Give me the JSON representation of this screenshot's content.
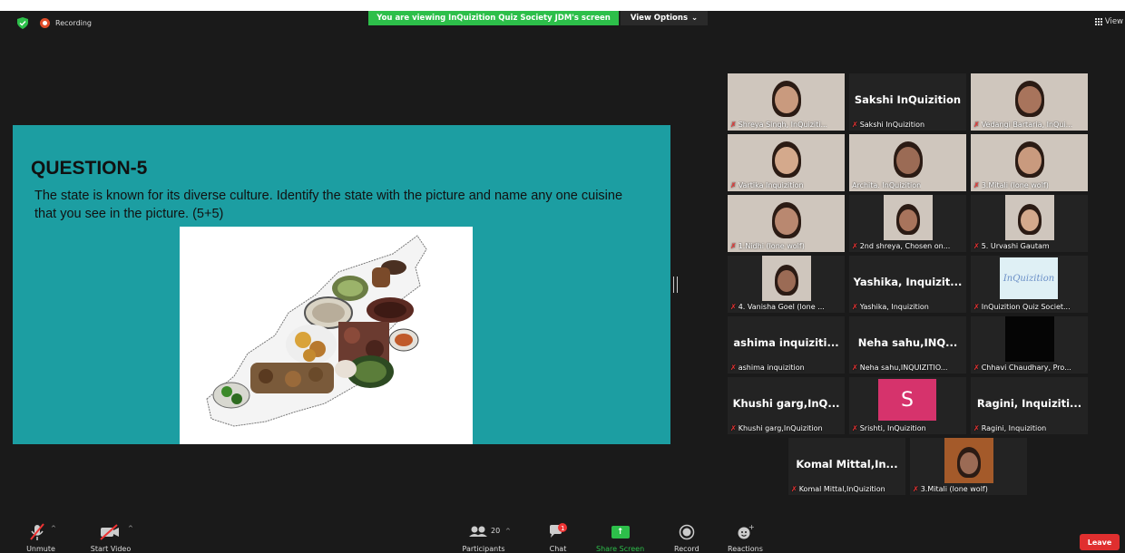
{
  "status": {
    "recording_label": "Recording"
  },
  "banner": {
    "viewing_text": "You are viewing InQuizition Quiz Society JDM's screen",
    "view_options": "View Options"
  },
  "view": {
    "label": "View"
  },
  "slide": {
    "title": "QUESTION-5",
    "text": "The state is known for its diverse culture. Identify the state with the picture and name any one cuisine that you see in the picture.  (5+5)"
  },
  "participants_grid": [
    {
      "name": "Shreya Singh, InQuiziti...",
      "big": "",
      "video": true
    },
    {
      "name": "Sakshi InQuizition",
      "big": "Sakshi InQuizition",
      "video": false
    },
    {
      "name": "Vedangi Bartaria, InQui...",
      "big": "",
      "video": true
    },
    {
      "name": "Vartika Inquizition",
      "big": "",
      "video": true
    },
    {
      "name": "Archita. InQuizition",
      "big": "",
      "video": true,
      "active": true,
      "muted": false
    },
    {
      "name": "3.Mitali (lone wolf)",
      "big": "",
      "video": true
    },
    {
      "name": "1.Nidhi (lone wolf)",
      "big": "",
      "video": true
    },
    {
      "name": "2nd shreya, Chosen on...",
      "big": "",
      "video": true
    },
    {
      "name": "5. Urvashi Gautam",
      "big": "",
      "video": true
    },
    {
      "name": "4. Vanisha Goel (lone ...",
      "big": "",
      "video": true
    },
    {
      "name": "Yashika, Inquizition",
      "big": "Yashika,  Inquizit...",
      "video": false
    },
    {
      "name": "InQuizition Quiz Societ...",
      "big": "",
      "video": true,
      "logo": "InQuizition"
    },
    {
      "name": "ashima inquizition",
      "big": "ashima  inquiziti...",
      "video": false
    },
    {
      "name": "Neha sahu,INQUIZITIO...",
      "big": "Neha  sahu,INQ...",
      "video": false
    },
    {
      "name": "Chhavi Chaudhary, Pro...",
      "big": "",
      "video": true
    },
    {
      "name": "Khushi garg,InQuizition",
      "big": "Khushi  garg,InQ...",
      "video": false
    },
    {
      "name": "Srishti, InQuizition",
      "big": "",
      "video": false,
      "avatar_letter": "S"
    },
    {
      "name": "Ragini, Inquizition",
      "big": "Ragini,  Inquiziti...",
      "video": false
    },
    {
      "name": "Komal Mittal,InQuizition",
      "big": "Komal  Mittal,In...",
      "video": false
    },
    {
      "name": "3.Mitali (lone wolf)",
      "big": "",
      "video": true
    }
  ],
  "toolbar": {
    "unmute": "Unmute",
    "start_video": "Start Video",
    "participants": "Participants",
    "participants_count": "20",
    "chat": "Chat",
    "chat_badge": "1",
    "share_screen": "Share Screen",
    "record": "Record",
    "reactions": "Reactions",
    "leave": "Leave"
  },
  "colors": {
    "slide_bg": "#1c9ea2",
    "banner_green": "#2dbf4a",
    "leave_red": "#e02f2f",
    "active_border": "#c8d86b",
    "srishti_avatar": "#d6336c"
  }
}
